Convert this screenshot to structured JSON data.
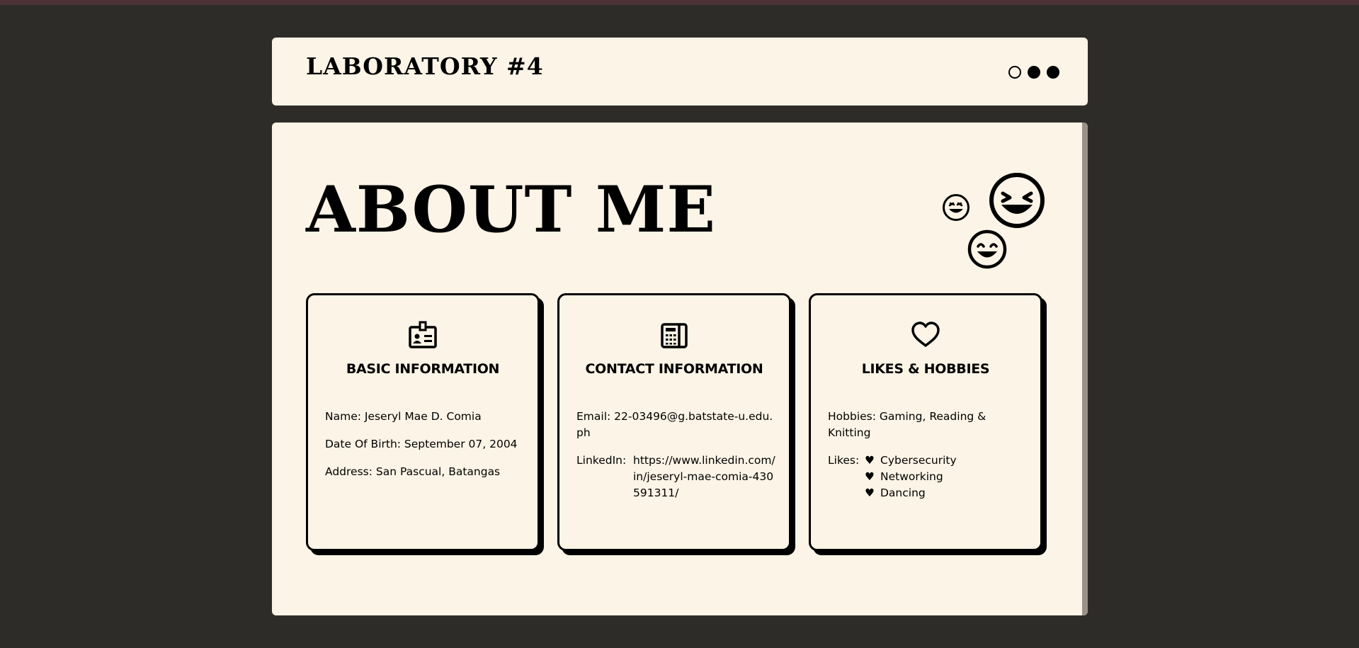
{
  "header": {
    "title": "LABORATORY #4"
  },
  "page": {
    "title": "ABOUT ME"
  },
  "cards": {
    "basic": {
      "icon": "id-badge-icon",
      "title": "BASIC INFORMATION",
      "name": "Name: Jeseryl Mae D. Comia",
      "dob": "Date Of Birth: September 07, 2004",
      "address": "Address: San Pascual, Batangas"
    },
    "contact": {
      "icon": "phone-icon",
      "title": "CONTACT INFORMATION",
      "email_label": "Email:",
      "email_value": "22-03496@g.batstate-u.edu.ph",
      "linkedin_label": "LinkedIn:",
      "linkedin_value": "https://www.linkedin.com/in/jeseryl-mae-comia-430591311/"
    },
    "hobbies": {
      "icon": "heart-icon",
      "title": "LIKES & HOBBIES",
      "hobbies": "Hobbies: Gaming, Reading & Knitting",
      "likes_label": "Likes:",
      "likes": [
        "Cybersecurity",
        "Networking",
        "Dancing"
      ],
      "bullet": "♥"
    }
  },
  "colors": {
    "background": "#2e2c28",
    "card": "#fcf4e6",
    "ink": "#000000",
    "top_strip": "#4a3238"
  }
}
